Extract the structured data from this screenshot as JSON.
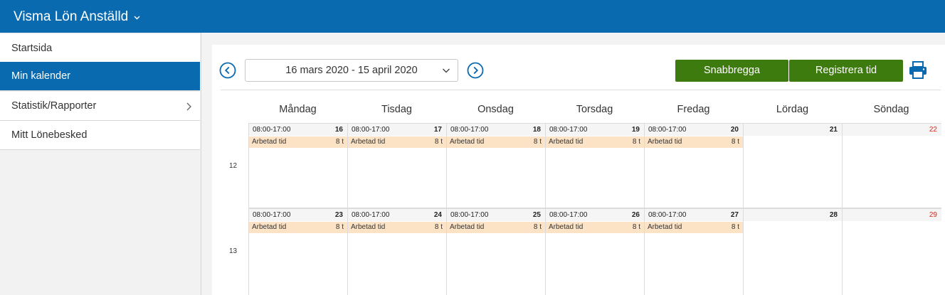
{
  "app": {
    "title": "Visma Lön Anställd"
  },
  "sidebar": {
    "items": [
      {
        "label": "Startsida"
      },
      {
        "label": "Min kalender"
      },
      {
        "label": "Statistik/Rapporter"
      },
      {
        "label": "Mitt Lönebesked"
      }
    ]
  },
  "toolbar": {
    "date_range": "16 mars 2020 - 15 april 2020",
    "quick_button": "Snabbregga",
    "register_button": "Registrera tid"
  },
  "calendar": {
    "days": [
      "Måndag",
      "Tisdag",
      "Onsdag",
      "Torsdag",
      "Fredag",
      "Lördag",
      "Söndag"
    ],
    "weeks": [
      {
        "number": "12",
        "cells": [
          {
            "day": "16",
            "time": "08:00-17:00",
            "entry": "Arbetad tid",
            "hours": "8 t"
          },
          {
            "day": "17",
            "time": "08:00-17:00",
            "entry": "Arbetad tid",
            "hours": "8 t"
          },
          {
            "day": "18",
            "time": "08:00-17:00",
            "entry": "Arbetad tid",
            "hours": "8 t"
          },
          {
            "day": "19",
            "time": "08:00-17:00",
            "entry": "Arbetad tid",
            "hours": "8 t"
          },
          {
            "day": "20",
            "time": "08:00-17:00",
            "entry": "Arbetad tid",
            "hours": "8 t"
          },
          {
            "day": "21",
            "time": "",
            "entry": "",
            "hours": ""
          },
          {
            "day": "22",
            "time": "",
            "entry": "",
            "hours": ""
          }
        ]
      },
      {
        "number": "13",
        "cells": [
          {
            "day": "23",
            "time": "08:00-17:00",
            "entry": "Arbetad tid",
            "hours": "8 t"
          },
          {
            "day": "24",
            "time": "08:00-17:00",
            "entry": "Arbetad tid",
            "hours": "8 t"
          },
          {
            "day": "25",
            "time": "08:00-17:00",
            "entry": "Arbetad tid",
            "hours": "8 t"
          },
          {
            "day": "26",
            "time": "08:00-17:00",
            "entry": "Arbetad tid",
            "hours": "8 t"
          },
          {
            "day": "27",
            "time": "08:00-17:00",
            "entry": "Arbetad tid",
            "hours": "8 t"
          },
          {
            "day": "28",
            "time": "",
            "entry": "",
            "hours": ""
          },
          {
            "day": "29",
            "time": "",
            "entry": "",
            "hours": ""
          }
        ]
      }
    ]
  },
  "colors": {
    "brand_blue": "#0a6ab0",
    "button_green": "#3e7b0e",
    "entry_bg": "#fde3c6",
    "sunday_red": "#d52b1e"
  },
  "icons": [
    "chevron-down-icon",
    "chevron-right-icon",
    "prev-circle-icon",
    "next-circle-icon",
    "print-icon"
  ]
}
